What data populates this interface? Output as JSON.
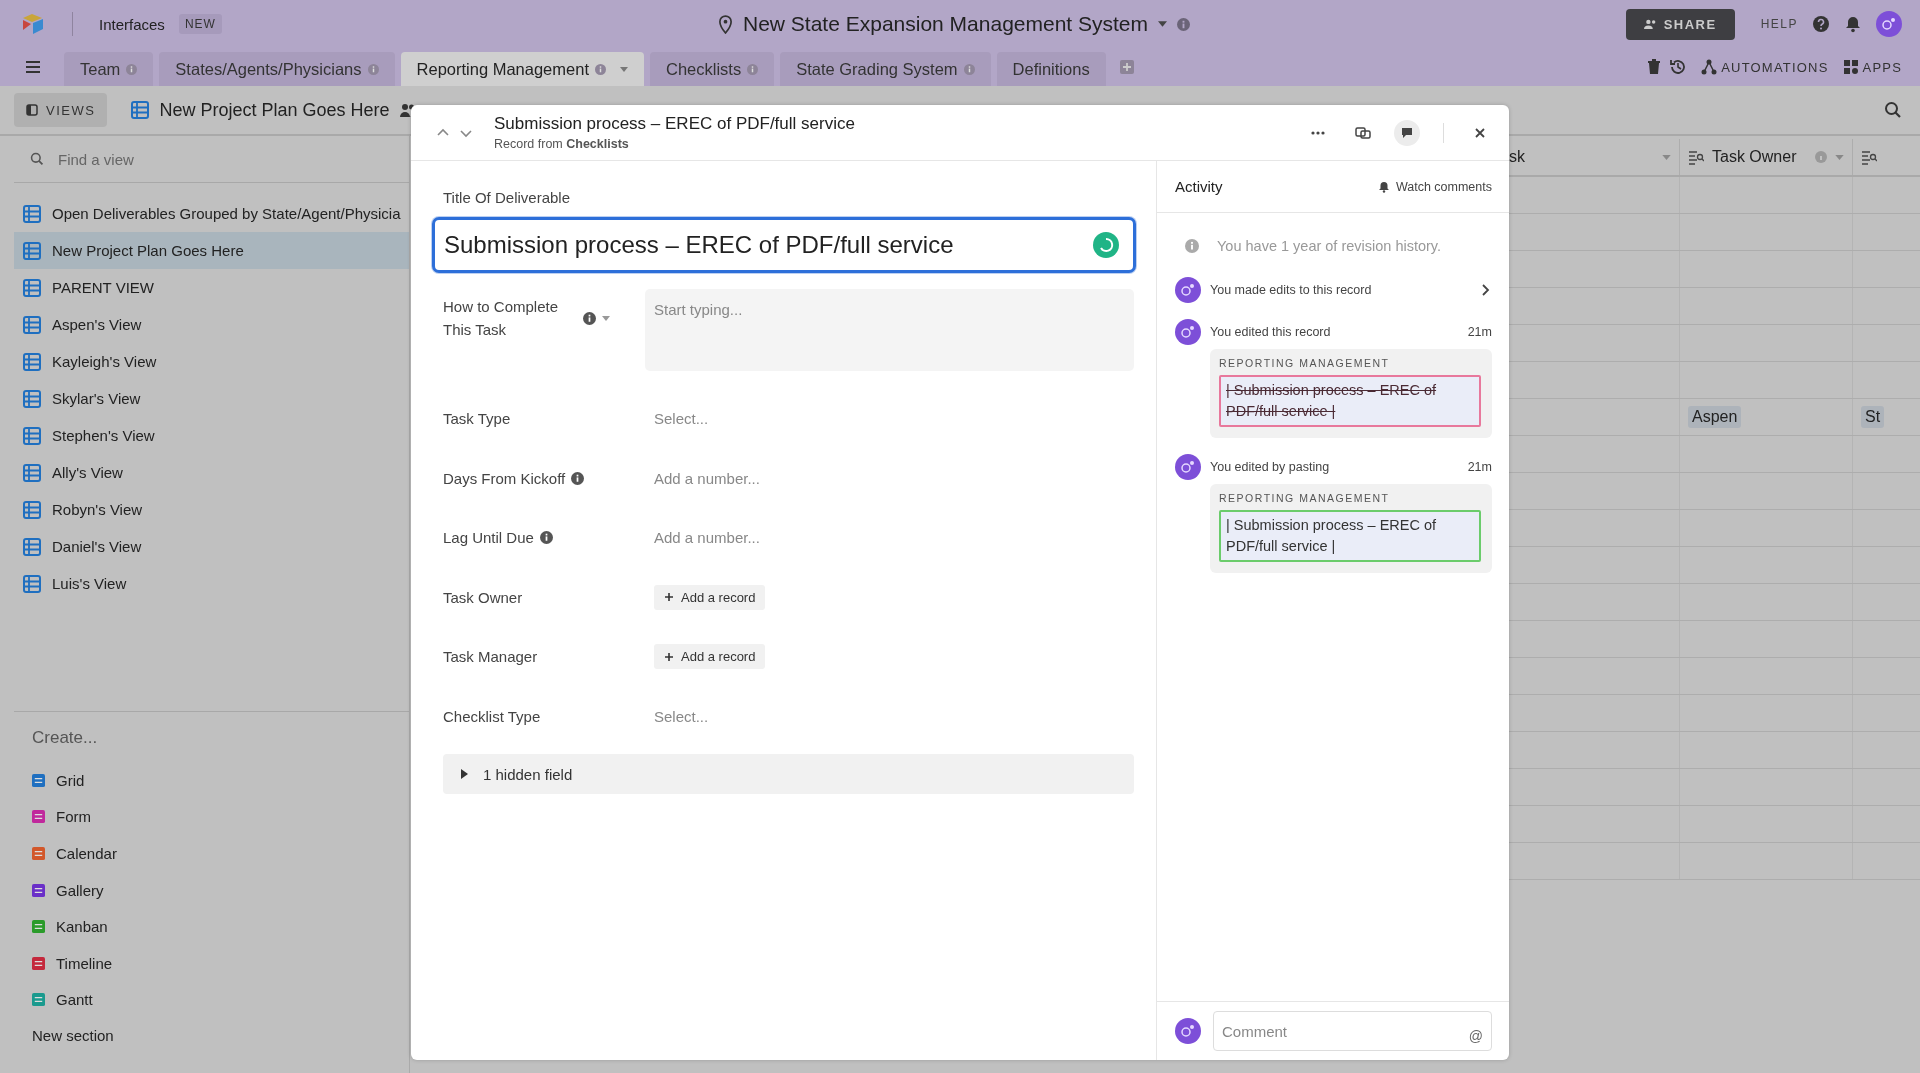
{
  "topbar": {
    "app_label": "Interfaces",
    "badge": "NEW",
    "base_title": "New State Expansion Management System",
    "share": "SHARE",
    "help": "HELP"
  },
  "tabs": [
    {
      "label": "Team",
      "selected": false,
      "info": true
    },
    {
      "label": "States/Agents/Physicians",
      "selected": false,
      "info": true
    },
    {
      "label": "Reporting Management",
      "selected": true,
      "info": true
    },
    {
      "label": "Checklists",
      "selected": false,
      "info": true
    },
    {
      "label": "State Grading System",
      "selected": false,
      "info": true
    },
    {
      "label": "Definitions",
      "selected": false,
      "info": false
    }
  ],
  "toolbar": {
    "automations": "AUTOMATIONS",
    "apps": "APPS"
  },
  "views_bar": {
    "views": "VIEWS",
    "current_view": "New Project Plan Goes Here"
  },
  "sidebar": {
    "search_placeholder": "Find a view",
    "views": [
      {
        "label": "Open Deliverables Grouped by State/Agent/Physicia",
        "selected": false
      },
      {
        "label": "New Project Plan Goes Here",
        "selected": true
      },
      {
        "label": "PARENT VIEW",
        "selected": false
      },
      {
        "label": "Aspen's View",
        "selected": false
      },
      {
        "label": "Kayleigh's View",
        "selected": false
      },
      {
        "label": "Skylar's View",
        "selected": false
      },
      {
        "label": "Stephen's View",
        "selected": false
      },
      {
        "label": "Ally's View",
        "selected": false
      },
      {
        "label": "Robyn's View",
        "selected": false
      },
      {
        "label": "Daniel's View",
        "selected": false
      },
      {
        "label": "Luis's View",
        "selected": false
      }
    ],
    "create_heading": "Create...",
    "create_items": [
      {
        "label": "Grid",
        "color": "#1f6fc0"
      },
      {
        "label": "Form",
        "color": "#c0289c"
      },
      {
        "label": "Calendar",
        "color": "#d2572a"
      },
      {
        "label": "Gallery",
        "color": "#6a2fc8"
      },
      {
        "label": "Kanban",
        "color": "#2a9b2a"
      },
      {
        "label": "Timeline",
        "color": "#c4283c"
      },
      {
        "label": "Gantt",
        "color": "#1a9a8e"
      }
    ],
    "new_section": "New section"
  },
  "table": {
    "columns": [
      {
        "label": "sk"
      },
      {
        "label": "Task Owner",
        "info": true
      }
    ],
    "records": [
      {
        "task_owner": "Aspen",
        "column_3": "St"
      }
    ]
  },
  "record": {
    "title": "Submission process – EREC of PDF/full service",
    "source": "Record from **Checklists**",
    "title_field": {
      "label": "Title Of Deliverable",
      "value": "Submission process – EREC of PDF/full service"
    },
    "fields": [
      {
        "label": "How to Complete This Task",
        "kind": "longtext",
        "placeholder": "Start typing...",
        "info": true
      },
      {
        "label": "Task Type",
        "kind": "select",
        "placeholder": "Select...",
        "info": false
      },
      {
        "label": "Days From Kickoff",
        "kind": "number",
        "placeholder": "Add a number...",
        "info": true
      },
      {
        "label": "Lag Until Due",
        "kind": "number",
        "placeholder": "Add a number...",
        "info": true
      },
      {
        "label": "Task Owner",
        "kind": "link",
        "button": "Add a record",
        "info": false
      },
      {
        "label": "Task Manager",
        "kind": "link",
        "button": "Add a record",
        "info": false
      },
      {
        "label": "Checklist Type",
        "kind": "select",
        "placeholder": "Select...",
        "info": false
      }
    ],
    "hidden_fields": "1 hidden field"
  },
  "activity": {
    "heading": "Activity",
    "watch": "Watch comments",
    "notice": "You have 1 year of revision history.",
    "entries": [
      {
        "kind": "summary",
        "text": "You made edits to this record"
      },
      {
        "kind": "change",
        "text": "You edited this record",
        "time": "21m",
        "table": "REPORTING MANAGEMENT",
        "value": "| Submission process – EREC of PDF/full service |",
        "deleted": true
      },
      {
        "kind": "change",
        "text": "You edited by pasting",
        "time": "21m",
        "table": "REPORTING MANAGEMENT",
        "value": "| Submission process – EREC of PDF/full service |",
        "deleted": false
      }
    ],
    "comment_placeholder": "Comment",
    "mention": "@"
  }
}
